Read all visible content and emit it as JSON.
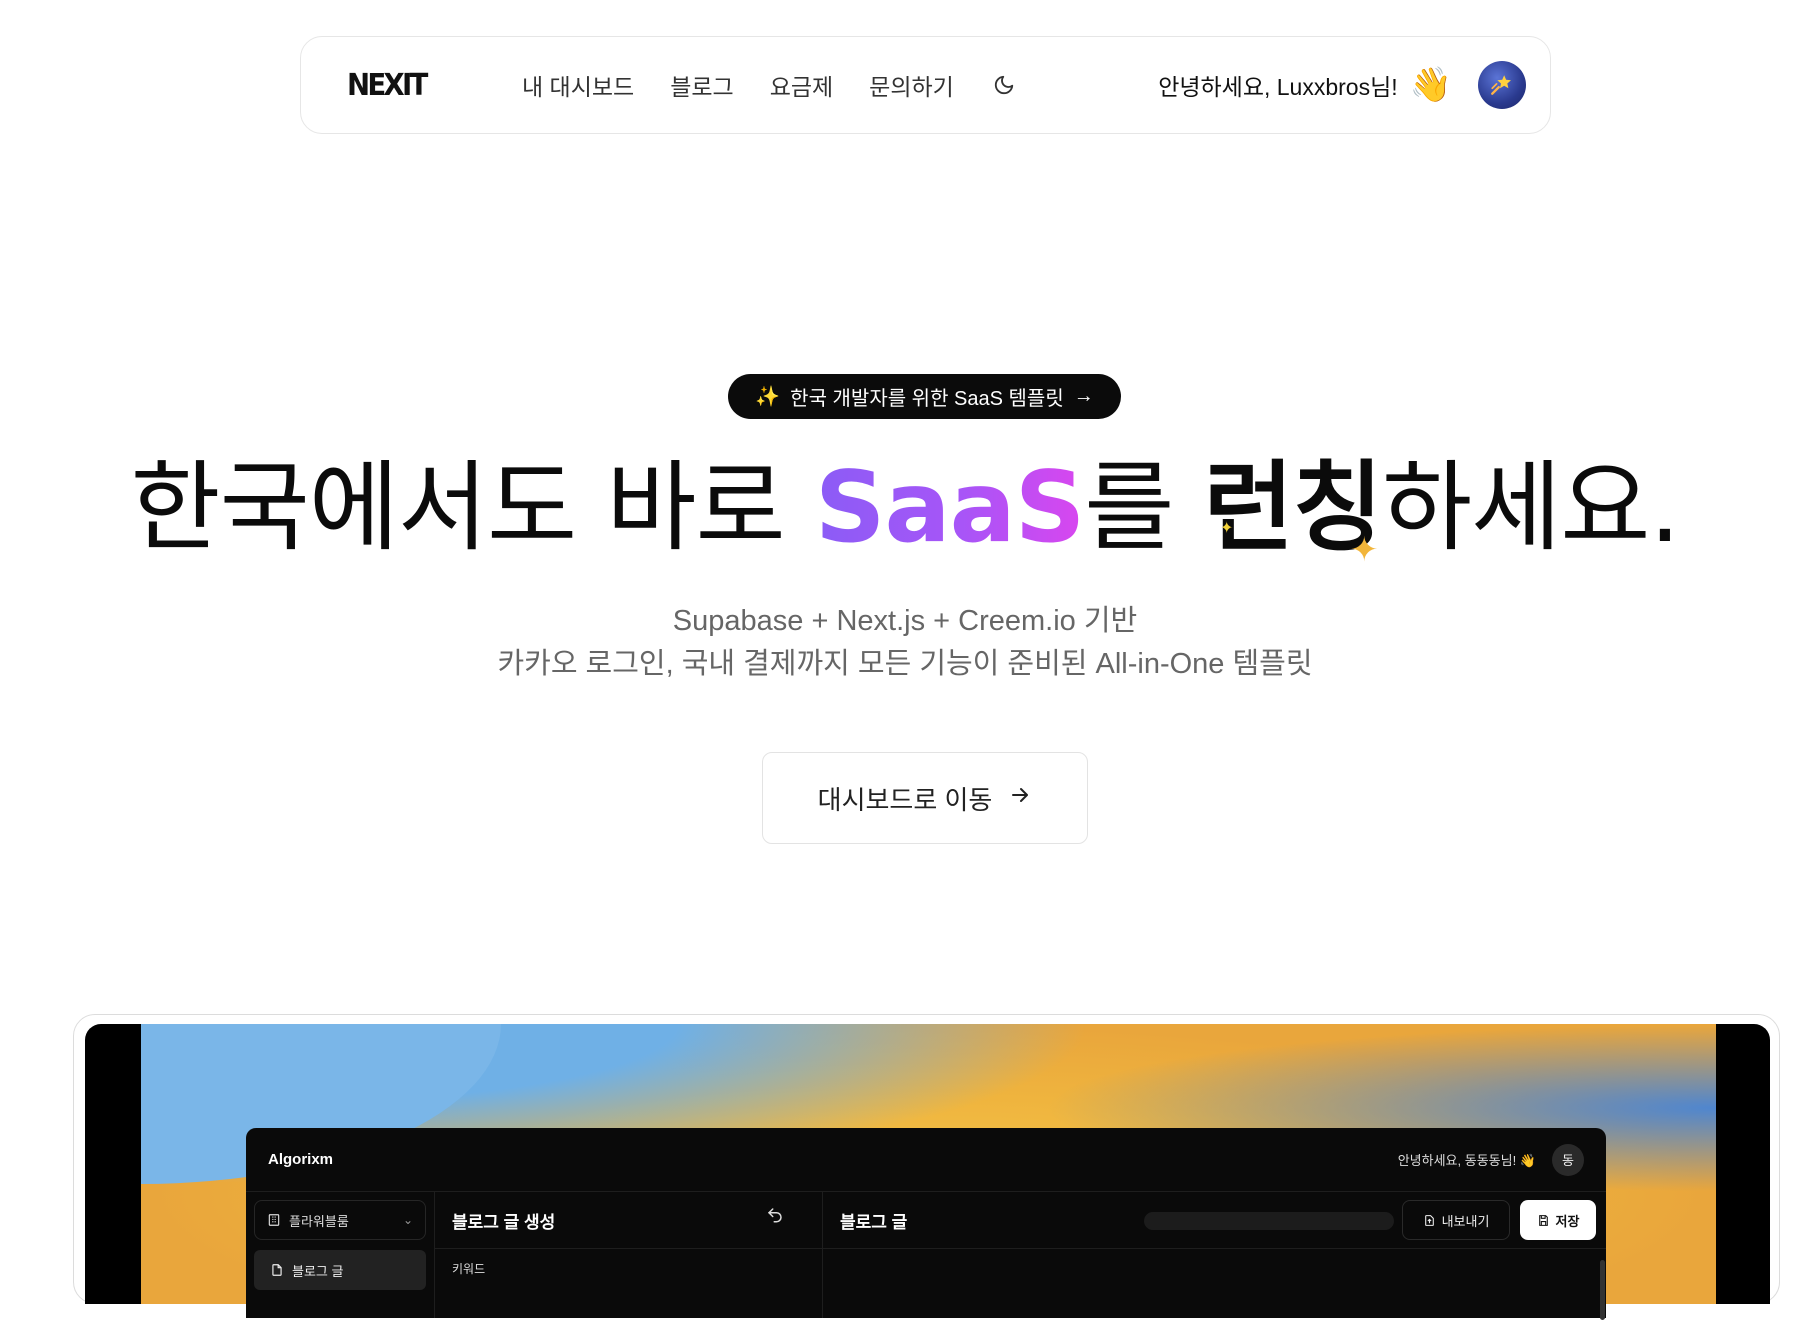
{
  "nav": {
    "logo": "NEXIT",
    "links": [
      "내 대시보드",
      "블로그",
      "요금제",
      "문의하기"
    ],
    "greeting": "안녕하세요, Luxxbros님!",
    "wave": "👋"
  },
  "hero": {
    "badge_spark": "✨",
    "badge_text": "한국 개발자를 위한 SaaS 템플릿",
    "badge_arrow": "→",
    "headline_part1": "한국에서도 바로 ",
    "headline_saas": "SaaS",
    "headline_part2": "를 ",
    "headline_launch": "런칭",
    "headline_part3": "하세요.",
    "subtitle_line1": "Supabase + Next.js + Creem.io 기반",
    "subtitle_line2": "카카오 로그인, 국내 결제까지 모든 기능이 준비된 All-in-One 템플릿",
    "cta_label": "대시보드로 이동",
    "cta_arrow": "→"
  },
  "preview": {
    "brand": "Algorixm",
    "greeting": "안녕하세요, 동동동님! 👋",
    "avatar_letter": "동",
    "workspace": "플라워블룸",
    "sidebar_item": "블로그 글",
    "panel_left_title": "블로그 글 생성",
    "keyword_label": "키워드",
    "panel_right_title": "블로그 글",
    "export_label": "내보내기",
    "save_label": "저장"
  },
  "icons": {
    "theme_toggle": "moon-icon",
    "avatar": "shooting-star-icon",
    "workspace": "building-icon",
    "chevron": "chevron-down-icon",
    "document": "file-icon",
    "undo": "undo-icon",
    "export": "file-export-icon",
    "save": "save-icon"
  },
  "colors": {
    "accent_gradient_start": "#8b5cf6",
    "accent_gradient_end": "#d946ef",
    "star": "#f2b53a"
  }
}
